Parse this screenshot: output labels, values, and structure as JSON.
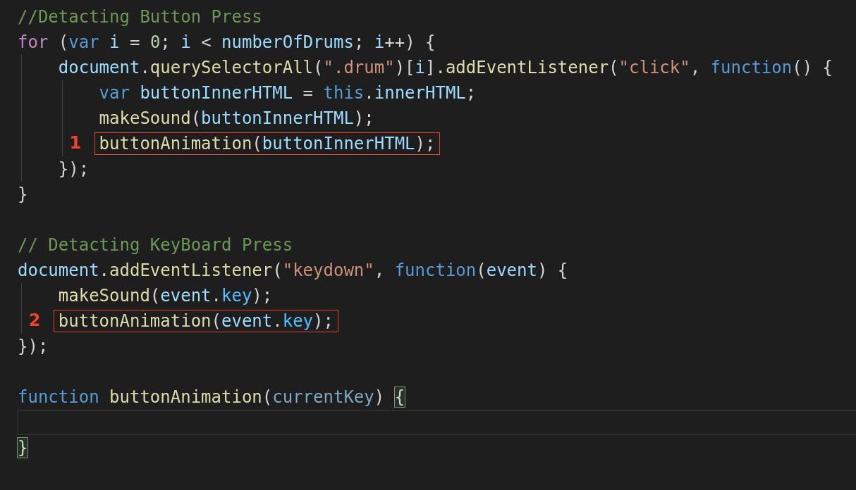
{
  "editor": {
    "lines": [
      {
        "current": false,
        "tokens": [
          {
            "kind": "comment",
            "text": "//Detacting Button Press"
          }
        ]
      },
      {
        "current": false,
        "tokens": [
          {
            "kind": "control",
            "text": "for"
          },
          {
            "kind": "punct",
            "text": " ("
          },
          {
            "kind": "storage",
            "text": "var"
          },
          {
            "kind": "variable",
            "text": " i"
          },
          {
            "kind": "punct",
            "text": " = "
          },
          {
            "kind": "number",
            "text": "0"
          },
          {
            "kind": "punct",
            "text": "; "
          },
          {
            "kind": "variable",
            "text": "i"
          },
          {
            "kind": "punct",
            "text": " < "
          },
          {
            "kind": "variable",
            "text": "numberOfDrums"
          },
          {
            "kind": "punct",
            "text": "; "
          },
          {
            "kind": "variable",
            "text": "i"
          },
          {
            "kind": "punct",
            "text": "++) {"
          }
        ],
        "children": [
          {
            "current": false,
            "tokens": [
              {
                "kind": "variable",
                "text": "document"
              },
              {
                "kind": "punct",
                "text": "."
              },
              {
                "kind": "function",
                "text": "querySelectorAll"
              },
              {
                "kind": "punct",
                "text": "("
              },
              {
                "kind": "string",
                "text": "\".drum\""
              },
              {
                "kind": "punct",
                "text": ")["
              },
              {
                "kind": "variable",
                "text": "i"
              },
              {
                "kind": "punct",
                "text": "]."
              },
              {
                "kind": "function",
                "text": "addEventListener"
              },
              {
                "kind": "punct",
                "text": "("
              },
              {
                "kind": "string",
                "text": "\"click\""
              },
              {
                "kind": "punct",
                "text": ", "
              },
              {
                "kind": "storage",
                "text": "function"
              },
              {
                "kind": "punct",
                "text": "() {"
              }
            ],
            "children": [
              {
                "current": false,
                "tokens": [
                  {
                    "kind": "storage",
                    "text": "var"
                  },
                  {
                    "kind": "variable",
                    "text": " buttonInnerHTML"
                  },
                  {
                    "kind": "punct",
                    "text": " = "
                  },
                  {
                    "kind": "storage",
                    "text": "this"
                  },
                  {
                    "kind": "punct",
                    "text": "."
                  },
                  {
                    "kind": "variable",
                    "text": "innerHTML"
                  },
                  {
                    "kind": "punct",
                    "text": ";"
                  }
                ]
              },
              {
                "current": false,
                "tokens": [
                  {
                    "kind": "function",
                    "text": "makeSound"
                  },
                  {
                    "kind": "punct",
                    "text": "("
                  },
                  {
                    "kind": "variable",
                    "text": "buttonInnerHTML"
                  },
                  {
                    "kind": "punct",
                    "text": ");"
                  }
                ]
              },
              {
                "current": false,
                "marker": "1",
                "tokens": [
                  {
                    "kind": "function",
                    "text": "buttonAnimation"
                  },
                  {
                    "kind": "punct",
                    "text": "("
                  },
                  {
                    "kind": "variable",
                    "text": "buttonInnerHTML"
                  },
                  {
                    "kind": "punct",
                    "text": ");"
                  }
                ]
              }
            ]
          },
          {
            "current": false,
            "tokens": [
              {
                "kind": "punct",
                "text": "});"
              }
            ]
          }
        ]
      },
      {
        "current": false,
        "tokens": [
          {
            "kind": "punct",
            "text": "}"
          }
        ]
      },
      {
        "current": false
      },
      {
        "current": false,
        "tokens": [
          {
            "kind": "comment",
            "text": "// Detacting KeyBoard Press"
          }
        ]
      },
      {
        "current": false,
        "tokens": [
          {
            "kind": "variable",
            "text": "document"
          },
          {
            "kind": "punct",
            "text": "."
          },
          {
            "kind": "function",
            "text": "addEventListener"
          },
          {
            "kind": "punct",
            "text": "("
          },
          {
            "kind": "string",
            "text": "\"keydown\""
          },
          {
            "kind": "punct",
            "text": ", "
          },
          {
            "kind": "storage",
            "text": "function"
          },
          {
            "kind": "punct",
            "text": "("
          },
          {
            "kind": "variable",
            "text": "event"
          },
          {
            "kind": "punct",
            "text": ") {"
          }
        ],
        "children": [
          {
            "current": false,
            "tokens": [
              {
                "kind": "function",
                "text": "makeSound"
              },
              {
                "kind": "punct",
                "text": "("
              },
              {
                "kind": "variable",
                "text": "event"
              },
              {
                "kind": "punct",
                "text": "."
              },
              {
                "kind": "property",
                "text": "key"
              },
              {
                "kind": "punct",
                "text": ");"
              }
            ]
          },
          {
            "current": false,
            "marker": "2",
            "tokens": [
              {
                "kind": "function",
                "text": "buttonAnimation"
              },
              {
                "kind": "punct",
                "text": "("
              },
              {
                "kind": "variable",
                "text": "event"
              },
              {
                "kind": "punct",
                "text": "."
              },
              {
                "kind": "property",
                "text": "key"
              },
              {
                "kind": "punct",
                "text": ");"
              }
            ]
          }
        ]
      },
      {
        "current": false,
        "tokens": [
          {
            "kind": "punct",
            "text": "});"
          }
        ]
      },
      {
        "current": false
      },
      {
        "current": false,
        "tokens": [
          {
            "kind": "storage",
            "text": "function"
          },
          {
            "kind": "function",
            "text": " buttonAnimation"
          },
          {
            "kind": "punct",
            "text": "("
          },
          {
            "kind": "unused",
            "text": "currentKey"
          },
          {
            "kind": "punct",
            "text": ") "
          },
          {
            "kind": "matched_bracket",
            "text": "{"
          }
        ]
      },
      {
        "current": true
      },
      {
        "current": false,
        "tokens": [
          {
            "kind": "matched_bracket",
            "text": "}"
          }
        ]
      }
    ]
  }
}
